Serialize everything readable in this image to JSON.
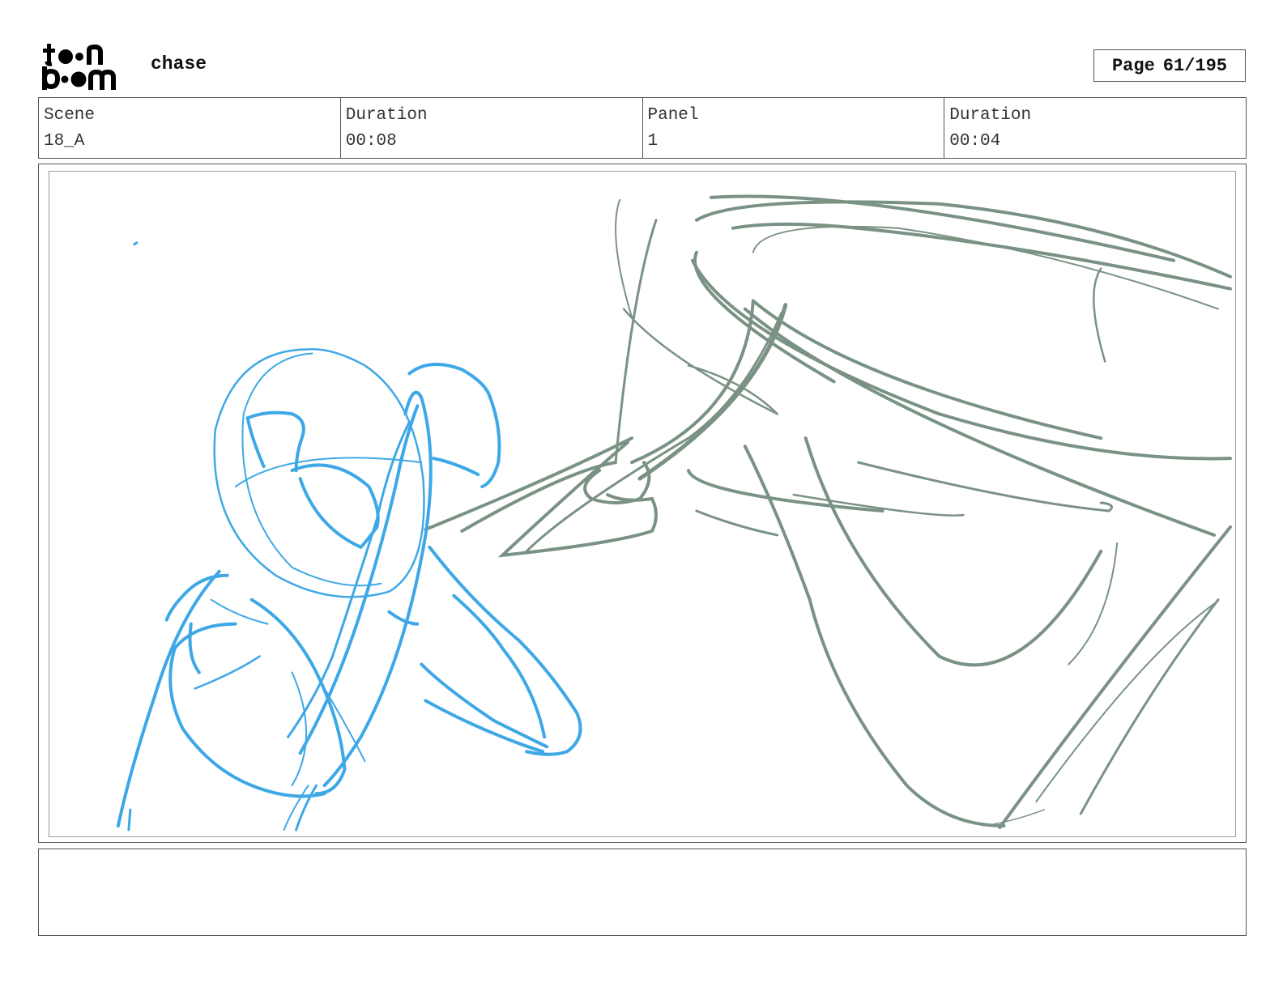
{
  "header": {
    "logo_text": "toon boom",
    "project_title": "chase",
    "page_label": "Page",
    "page_number": "61/195"
  },
  "info": {
    "scene_label": "Scene",
    "scene_value": "18_A",
    "scene_duration_label": "Duration",
    "scene_duration_value": "00:08",
    "panel_label": "Panel",
    "panel_value": "1",
    "panel_duration_label": "Duration",
    "panel_duration_value": "00:04"
  },
  "sketch": {
    "character_color": "#3ea8e6",
    "background_color": "#7a9284"
  },
  "caption": {
    "text": ""
  }
}
